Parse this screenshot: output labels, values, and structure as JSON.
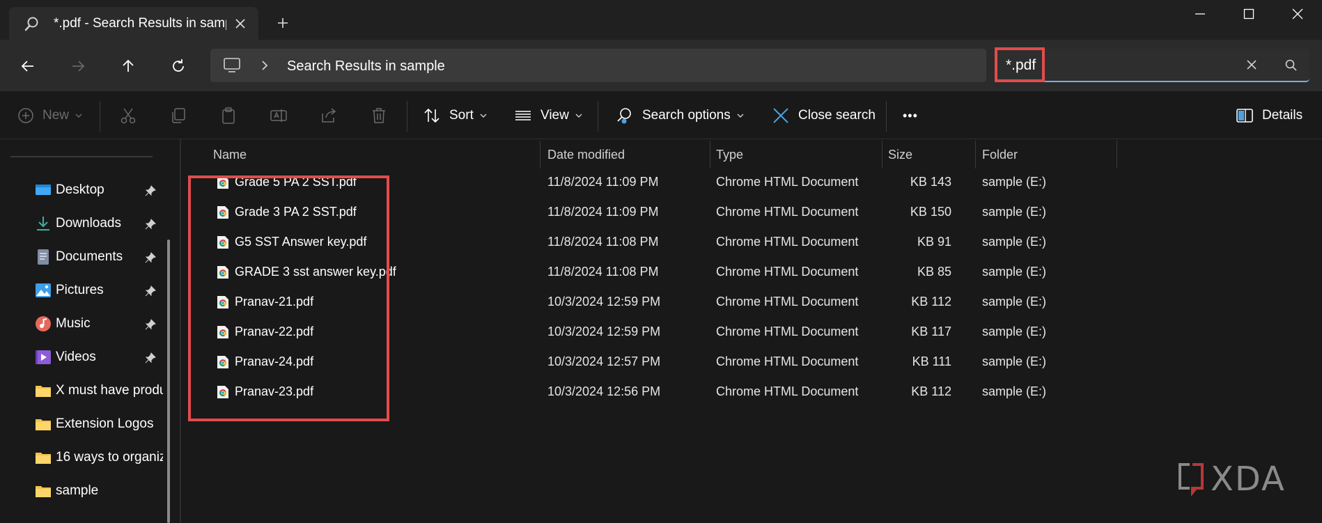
{
  "window": {
    "tab_title": "*.pdf - Search Results in sampl",
    "new_tab_glyph": "+"
  },
  "address_bar": {
    "breadcrumb": "Search Results in sample",
    "search_value": "*.pdf"
  },
  "command_bar": {
    "new_label": "New",
    "sort_label": "Sort",
    "view_label": "View",
    "search_options_label": "Search options",
    "close_search_label": "Close search",
    "more_label": "•••",
    "details_label": "Details"
  },
  "sidebar": {
    "items": [
      {
        "label": "Desktop",
        "icon": "desktop-icon",
        "pinned": true
      },
      {
        "label": "Downloads",
        "icon": "download-icon",
        "pinned": true
      },
      {
        "label": "Documents",
        "icon": "document-icon",
        "pinned": true
      },
      {
        "label": "Pictures",
        "icon": "pictures-icon",
        "pinned": true
      },
      {
        "label": "Music",
        "icon": "music-icon",
        "pinned": true
      },
      {
        "label": "Videos",
        "icon": "videos-icon",
        "pinned": true
      },
      {
        "label": "X must have produ",
        "icon": "folder-icon",
        "pinned": false
      },
      {
        "label": "Extension Logos",
        "icon": "folder-icon",
        "pinned": false
      },
      {
        "label": "16 ways to organiz",
        "icon": "folder-icon",
        "pinned": false
      },
      {
        "label": "sample",
        "icon": "folder-icon",
        "pinned": false
      }
    ]
  },
  "columns": [
    "Name",
    "Date modified",
    "Type",
    "Size",
    "Folder"
  ],
  "files": [
    {
      "name": "Grade 5 PA 2 SST.pdf",
      "date": "11/8/2024 11:09 PM",
      "type": "Chrome HTML Document",
      "size": "143 KB",
      "folder": "sample (E:)"
    },
    {
      "name": "Grade 3 PA 2 SST.pdf",
      "date": "11/8/2024 11:09 PM",
      "type": "Chrome HTML Document",
      "size": "150 KB",
      "folder": "sample (E:)"
    },
    {
      "name": "G5 SST Answer key.pdf",
      "date": "11/8/2024 11:08 PM",
      "type": "Chrome HTML Document",
      "size": "91 KB",
      "folder": "sample (E:)"
    },
    {
      "name": "GRADE 3 sst answer key.pdf",
      "date": "11/8/2024 11:08 PM",
      "type": "Chrome HTML Document",
      "size": "85 KB",
      "folder": "sample (E:)"
    },
    {
      "name": "Pranav-21.pdf",
      "date": "10/3/2024 12:59 PM",
      "type": "Chrome HTML Document",
      "size": "112 KB",
      "folder": "sample (E:)"
    },
    {
      "name": "Pranav-22.pdf",
      "date": "10/3/2024 12:59 PM",
      "type": "Chrome HTML Document",
      "size": "117 KB",
      "folder": "sample (E:)"
    },
    {
      "name": "Pranav-24.pdf",
      "date": "10/3/2024 12:57 PM",
      "type": "Chrome HTML Document",
      "size": "111 KB",
      "folder": "sample (E:)"
    },
    {
      "name": "Pranav-23.pdf",
      "date": "10/3/2024 12:56 PM",
      "type": "Chrome HTML Document",
      "size": "112 KB",
      "folder": "sample (E:)"
    }
  ],
  "watermark": {
    "text": "XDA"
  },
  "colors": {
    "highlight": "#e24c4c",
    "accent": "#6fb4e0",
    "background": "#191919"
  }
}
